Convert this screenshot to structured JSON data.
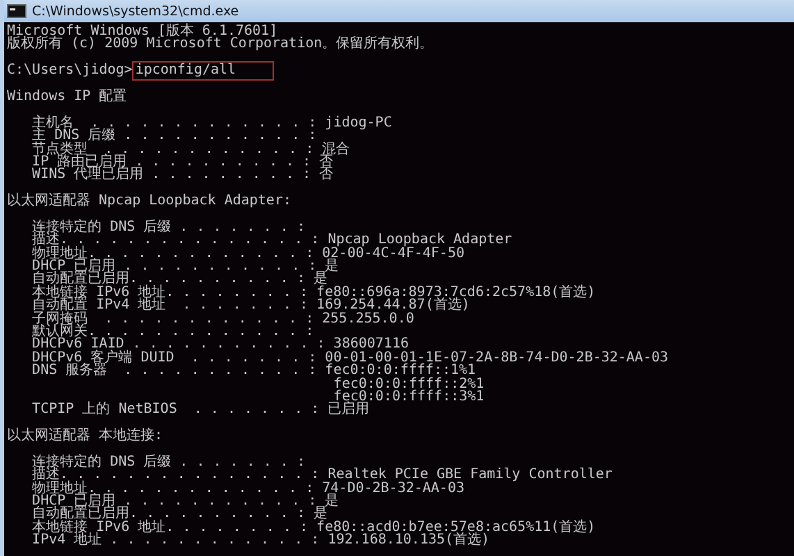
{
  "window": {
    "title": "C:\\Windows\\system32\\cmd.exe"
  },
  "lines": [
    {
      "kind": "text",
      "text": "Microsoft Windows [版本 6.1.7601]"
    },
    {
      "kind": "text",
      "text": "版权所有 (c) 2009 Microsoft Corporation。保留所有权利。"
    },
    {
      "kind": "blank"
    },
    {
      "kind": "command",
      "prompt": "C:\\Users\\jidog>",
      "command": "ipconfig/all"
    },
    {
      "kind": "blank"
    },
    {
      "kind": "text",
      "text": "Windows IP 配置"
    },
    {
      "kind": "blank"
    },
    {
      "kind": "text",
      "text": "   主机名  . . . . . . . . . . . . . : jidog-PC"
    },
    {
      "kind": "text",
      "text": "   主 DNS 后缀 . . . . . . . . . . . :"
    },
    {
      "kind": "text",
      "text": "   节点类型  . . . . . . . . . . . . : 混合"
    },
    {
      "kind": "text",
      "text": "   IP 路由已启用 . . . . . . . . . . : 否"
    },
    {
      "kind": "text",
      "text": "   WINS 代理已启用 . . . . . . . . . : 否"
    },
    {
      "kind": "blank"
    },
    {
      "kind": "text",
      "text": "以太网适配器 Npcap Loopback Adapter:"
    },
    {
      "kind": "blank"
    },
    {
      "kind": "text",
      "text": "   连接特定的 DNS 后缀 . . . . . . . :"
    },
    {
      "kind": "text",
      "text": "   描述. . . . . . . . . . . . . . . : Npcap Loopback Adapter"
    },
    {
      "kind": "text",
      "text": "   物理地址. . . . . . . . . . . . . : 02-00-4C-4F-4F-50"
    },
    {
      "kind": "text",
      "text": "   DHCP 已启用 . . . . . . . . . . . : 是"
    },
    {
      "kind": "text",
      "text": "   自动配置已启用. . . . . . . . . . : 是"
    },
    {
      "kind": "text",
      "text": "   本地链接 IPv6 地址. . . . . . . . : fe80::696a:8973:7cd6:2c57%18(首选)"
    },
    {
      "kind": "text",
      "text": "   自动配置 IPv4 地址  . . . . . . . : 169.254.44.87(首选)"
    },
    {
      "kind": "text",
      "text": "   子网掩码  . . . . . . . . . . . . : 255.255.0.0"
    },
    {
      "kind": "text",
      "text": "   默认网关. . . . . . . . . . . . . :"
    },
    {
      "kind": "text",
      "text": "   DHCPv6 IAID . . . . . . . . . . . : 386007116"
    },
    {
      "kind": "text",
      "text": "   DHCPv6 客户端 DUID  . . . . . . . : 00-01-00-01-1E-07-2A-8B-74-D0-2B-32-AA-03"
    },
    {
      "kind": "text",
      "text": "   DNS 服务器  . . . . . . . . . . . : fec0:0:0:ffff::1%1"
    },
    {
      "kind": "text",
      "text": "                                       fec0:0:0:ffff::2%1"
    },
    {
      "kind": "text",
      "text": "                                       fec0:0:0:ffff::3%1"
    },
    {
      "kind": "text",
      "text": "   TCPIP 上的 NetBIOS  . . . . . . . : 已启用"
    },
    {
      "kind": "blank"
    },
    {
      "kind": "text",
      "text": "以太网适配器 本地连接:"
    },
    {
      "kind": "blank"
    },
    {
      "kind": "text",
      "text": "   连接特定的 DNS 后缀 . . . . . . . :"
    },
    {
      "kind": "text",
      "text": "   描述. . . . . . . . . . . . . . . : Realtek PCIe GBE Family Controller"
    },
    {
      "kind": "text",
      "text": "   物理地址. . . . . . . . . . . . . : 74-D0-2B-32-AA-03"
    },
    {
      "kind": "text",
      "text": "   DHCP 已启用 . . . . . . . . . . . : 是"
    },
    {
      "kind": "text",
      "text": "   自动配置已启用. . . . . . . . . . : 是"
    },
    {
      "kind": "text",
      "text": "   本地链接 IPv6 地址. . . . . . . . : fe80::acd0:b7ee:57e8:ac65%11(首选)"
    },
    {
      "kind": "text",
      "text": "   IPv4 地址 . . . . . . . . . . . . : 192.168.10.135(首选)"
    }
  ]
}
